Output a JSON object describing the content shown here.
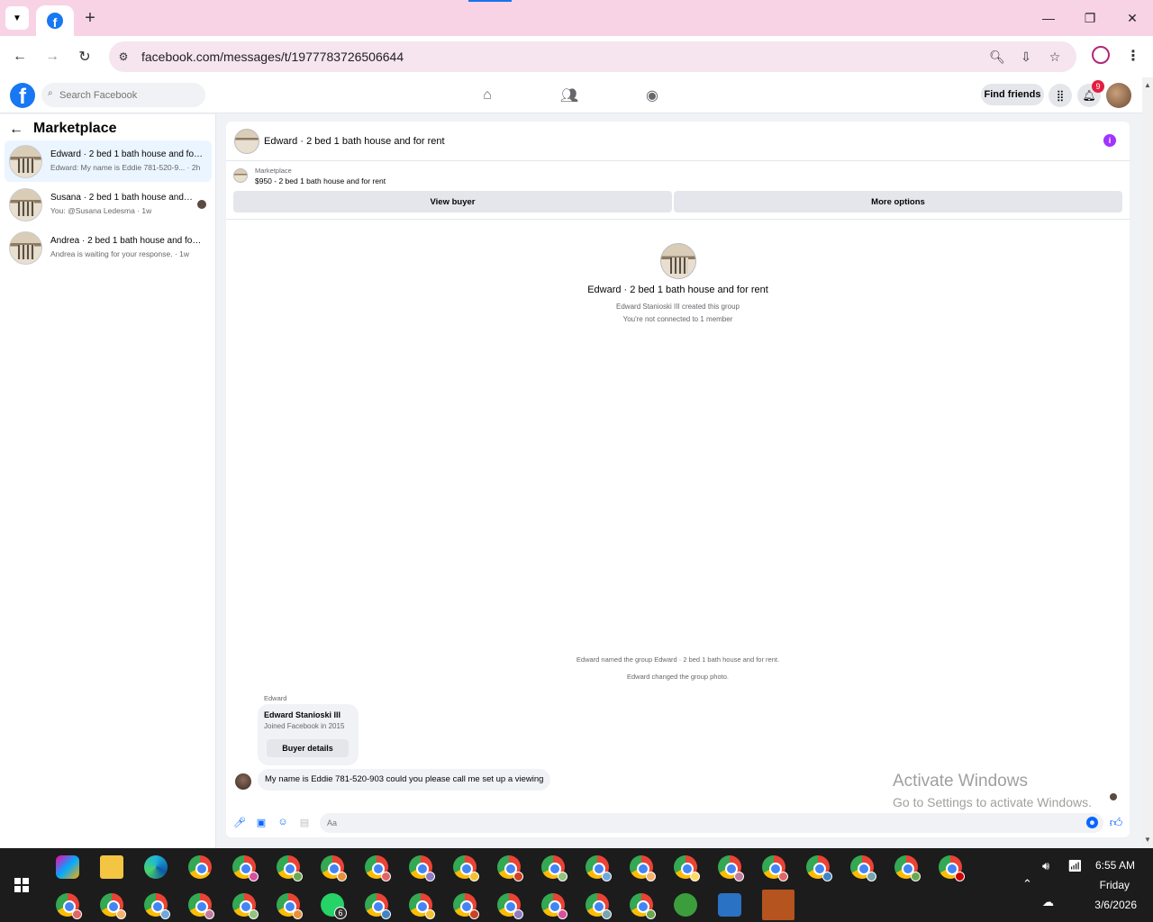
{
  "browser": {
    "url": "facebook.com/messages/t/1977783726506644",
    "new_tab": "+",
    "minimize": "—",
    "restore": "❐",
    "close": "✕"
  },
  "fb": {
    "search_placeholder": "Search Facebook",
    "find_friends": "Find friends",
    "notification_count": "9"
  },
  "sidebar": {
    "title": "Marketplace",
    "conversations": [
      {
        "name": "Edward · 2 bed 1 bath house and for rent",
        "snippet": "Edward: My name is Eddie 781-520-9...  · 2h",
        "active": true
      },
      {
        "name": "Susana · 2 bed 1 bath house and for rent",
        "snippet": "You: @Susana Ledesma · 1w",
        "active": false
      },
      {
        "name": "Andrea · 2 bed 1 bath house and for rent",
        "snippet": "Andrea is waiting for your response. · 1w",
        "active": false
      }
    ]
  },
  "chat": {
    "title": "Edward · 2 bed 1 bath house and for rent",
    "marketplace_label": "Marketplace",
    "listing": "$950 - 2 bed 1 bath house and for rent",
    "view_buyer": "View buyer",
    "more_options": "More options",
    "intro_title": "Edward · 2 bed 1 bath house and for rent",
    "intro_created": "Edward Stanioski III created this group",
    "intro_connection": "You're not connected to 1 member",
    "system_msg_1": "Edward named the group Edward · 2 bed 1 bath house and for rent.",
    "system_msg_2": "Edward changed the group photo.",
    "sender": "Edward",
    "buyer_name": "Edward Stanioski III",
    "buyer_joined": "Joined Facebook in 2015",
    "buyer_details": "Buyer details",
    "message": "My name is Eddie 781-520-903 could you please call me set up a viewing",
    "composer_placeholder": "Aa"
  },
  "watermark": {
    "line1": "Activate Windows",
    "line2": "Go to Settings to activate Windows."
  },
  "taskbar": {
    "time": "6:55 AM",
    "day": "Friday",
    "date": "3/6/2026",
    "whatsapp_count": "6"
  }
}
